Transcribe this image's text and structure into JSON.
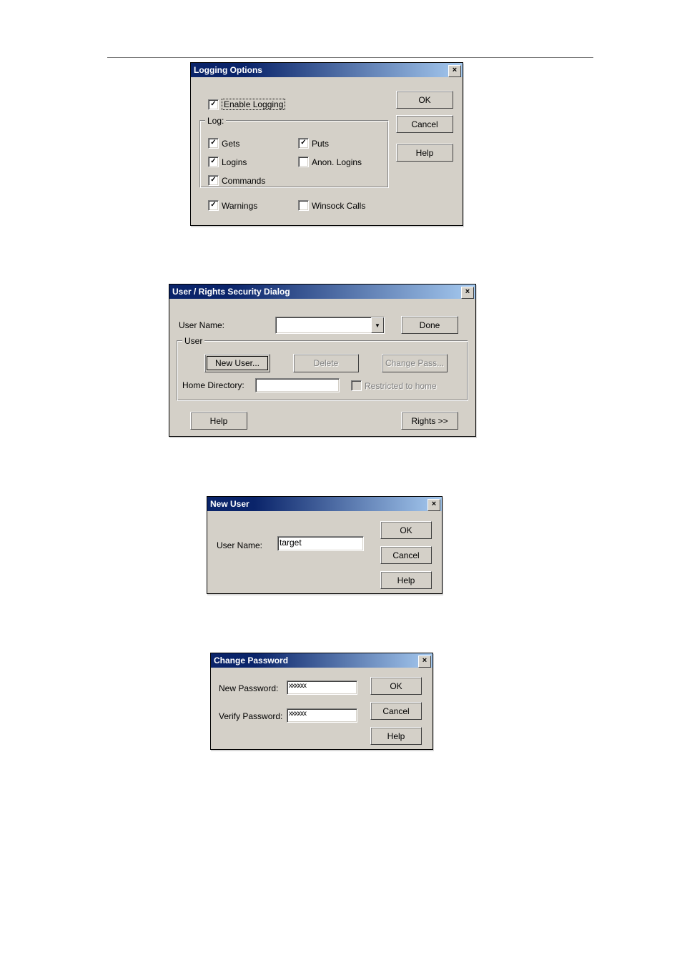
{
  "logging": {
    "title": "Logging Options",
    "enable_label": "Enable Logging",
    "group_label": "Log:",
    "gets_label": "Gets",
    "puts_label": "Puts",
    "logins_label": "Logins",
    "anon_logins_label": "Anon. Logins",
    "commands_label": "Commands",
    "warnings_label": "Warnings",
    "winsock_label": "Winsock Calls",
    "ok_label": "OK",
    "cancel_label": "Cancel",
    "help_label": "Help",
    "checked": {
      "enable": true,
      "gets": true,
      "puts": true,
      "logins": true,
      "anon_logins": false,
      "commands": true,
      "warnings": true,
      "winsock": false
    }
  },
  "rights": {
    "title": "User / Rights Security Dialog",
    "username_label": "User Name:",
    "username_value": "",
    "done_label": "Done",
    "group_label": "User",
    "newuser_label": "New User...",
    "delete_label": "Delete",
    "changepass_label": "Change Pass...",
    "homedir_label": "Home Directory:",
    "homedir_value": "",
    "restricted_label": "Restricted to home",
    "help_label": "Help",
    "rights_label": "Rights >>"
  },
  "newuser": {
    "title": "New User",
    "username_label": "User Name:",
    "username_value": "target",
    "ok_label": "OK",
    "cancel_label": "Cancel",
    "help_label": "Help"
  },
  "changepw": {
    "title": "Change Password",
    "newpw_label": "New Password:",
    "newpw_value": "xxxxxx",
    "verify_label": "Verify Password:",
    "verify_value": "xxxxxx",
    "ok_label": "OK",
    "cancel_label": "Cancel",
    "help_label": "Help"
  }
}
